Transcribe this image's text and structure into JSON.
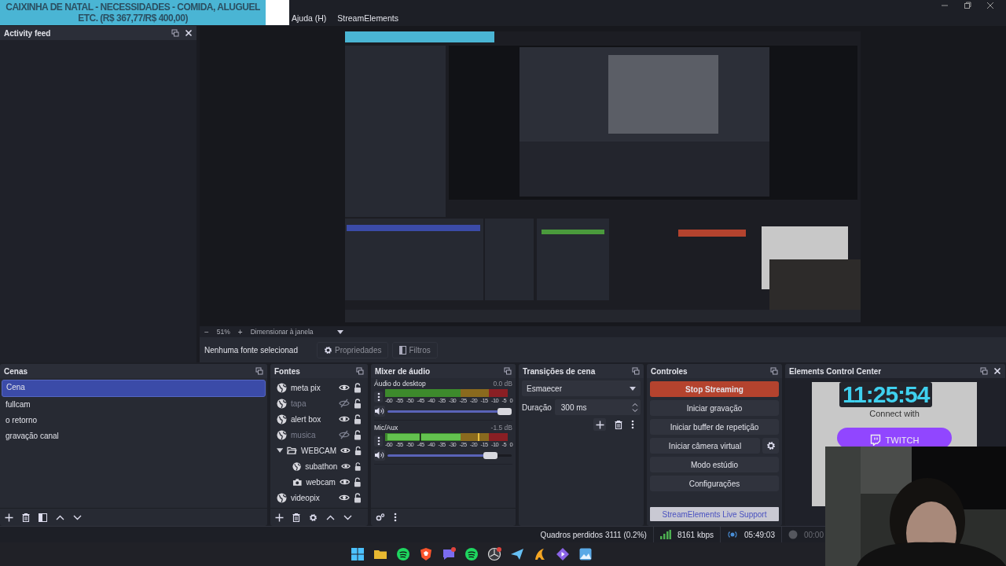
{
  "overlay_banner": {
    "text": "CAIXINHA DE NATAL - NECESSIDADES - COMIDA, ALUGUEL ETC. (R$ 367,77/R$ 400,00)"
  },
  "menu": [
    "Ajuda (H)",
    "StreamElements"
  ],
  "activity_feed": {
    "title": "Activity feed"
  },
  "zoom_bar": {
    "minus": "−",
    "zoom": "51%",
    "plus": "+",
    "fit": "Dimensionar à janela"
  },
  "context_bar": {
    "status": "Nenhuma fonte selecionad",
    "buttons": [
      {
        "label": "Propriedades",
        "kind": "properties"
      },
      {
        "label": "Filtros",
        "kind": "filters"
      }
    ]
  },
  "scenes": {
    "title": "Cenas",
    "items": [
      {
        "label": "Cena",
        "selected": true
      },
      {
        "label": "fullcam",
        "selected": false
      },
      {
        "label": "o retorno",
        "selected": false
      },
      {
        "label": "gravação canal",
        "selected": false
      }
    ]
  },
  "sources": {
    "title": "Fontes",
    "items": [
      {
        "label": "meta pix",
        "kind": "browser",
        "visible": true
      },
      {
        "label": "tapa",
        "kind": "browser",
        "visible": false
      },
      {
        "label": "alert box",
        "kind": "browser",
        "visible": true
      },
      {
        "label": "musica",
        "kind": "browser",
        "visible": false
      },
      {
        "label": "WEBCAM",
        "kind": "group",
        "visible": true,
        "expanded": true,
        "children": [
          {
            "label": "subathon",
            "kind": "browser",
            "visible": true
          },
          {
            "label": "webcam",
            "kind": "camera",
            "visible": true
          }
        ]
      },
      {
        "label": "videopix",
        "kind": "browser",
        "visible": true
      }
    ]
  },
  "mixer": {
    "title": "Mixer de áudio",
    "channels": [
      {
        "name": "Áudio do desktop",
        "reading": "0.0 dB",
        "level": 1.0,
        "scale": [
          "-60",
          "-55",
          "-50",
          "-45",
          "-40",
          "-35",
          "-30",
          "-25",
          "-20",
          "-15",
          "-10",
          "-5",
          "0"
        ]
      },
      {
        "name": "Mic/Aux",
        "reading": "-1.5 dB",
        "level": 0.87,
        "scale": [
          "-60",
          "-55",
          "-50",
          "-45",
          "-40",
          "-35",
          "-30",
          "-25",
          "-20",
          "-15",
          "-10",
          "-5",
          "0"
        ]
      }
    ]
  },
  "transitions": {
    "title": "Transições de cena",
    "transition": "Esmaecer",
    "duration_label": "Duração",
    "duration": "300 ms"
  },
  "controls": {
    "title": "Controles",
    "buttons": [
      {
        "label": "Stop Streaming",
        "kind": "stop"
      },
      {
        "label": "Iniciar gravação",
        "kind": "normal"
      },
      {
        "label": "Iniciar buffer de repetição",
        "kind": "normal"
      },
      {
        "label": "Iniciar câmera virtual",
        "kind": "with_settings"
      },
      {
        "label": "Modo estúdio",
        "kind": "normal"
      },
      {
        "label": "Configurações",
        "kind": "normal"
      }
    ],
    "support": "StreamElements Live Support"
  },
  "elements": {
    "title": "Elements Control Center",
    "connect": "Connect with",
    "twitch": "TWITCH"
  },
  "timer": "11:25:54",
  "status_bar": {
    "dropped": "Quadros perdidos 3111 (0.2%)",
    "bitrate": "8161 kbps",
    "stream_time": "05:49:03",
    "record_time": "00:00"
  }
}
